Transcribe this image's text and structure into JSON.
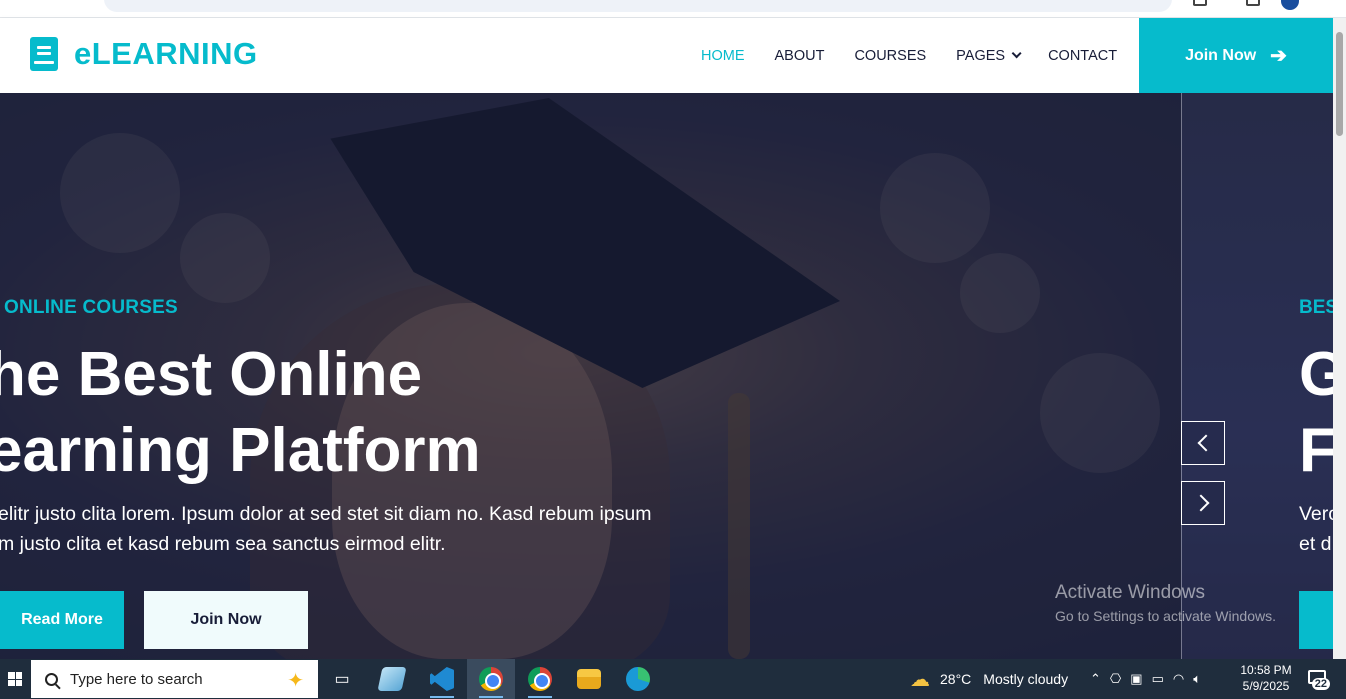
{
  "brand": {
    "name": "eLEARNING"
  },
  "nav": {
    "links": [
      "HOME",
      "ABOUT",
      "COURSES",
      "PAGES",
      "CONTACT"
    ],
    "active": "HOME",
    "join_label": "Join Now",
    "join_icon": "arrow-right-icon"
  },
  "hero": {
    "subtitle": "ONLINE COURSES",
    "title_line1": "he Best Online",
    "title_line2": "earning Platform",
    "desc_line1": "elitr justo clita lorem. Ipsum dolor at sed stet sit diam no. Kasd rebum ipsum",
    "desc_line2": "m justo clita et kasd rebum sea sanctus eirmod elitr.",
    "read_more": "Read More",
    "join_now": "Join Now"
  },
  "next_slide": {
    "subtitle": "BES",
    "title_line1": "G",
    "title_line2": "F",
    "desc_line1": "Vero",
    "desc_line2": "et d"
  },
  "watermark": {
    "line1": "Activate Windows",
    "line2": "Go to Settings to activate Windows."
  },
  "taskbar": {
    "search_placeholder": "Type here to search",
    "apps": [
      "task-view",
      "notepad",
      "vscode",
      "chrome",
      "chrome",
      "file-explorer",
      "edge"
    ],
    "weather_temp": "28°C",
    "weather_desc": "Mostly cloudy",
    "time": "10:58 PM",
    "date": "5/9/2025",
    "notifications": "22"
  },
  "colors": {
    "accent": "#06bbcc",
    "dark": "#181d38",
    "taskbar": "#1f2d3d"
  }
}
